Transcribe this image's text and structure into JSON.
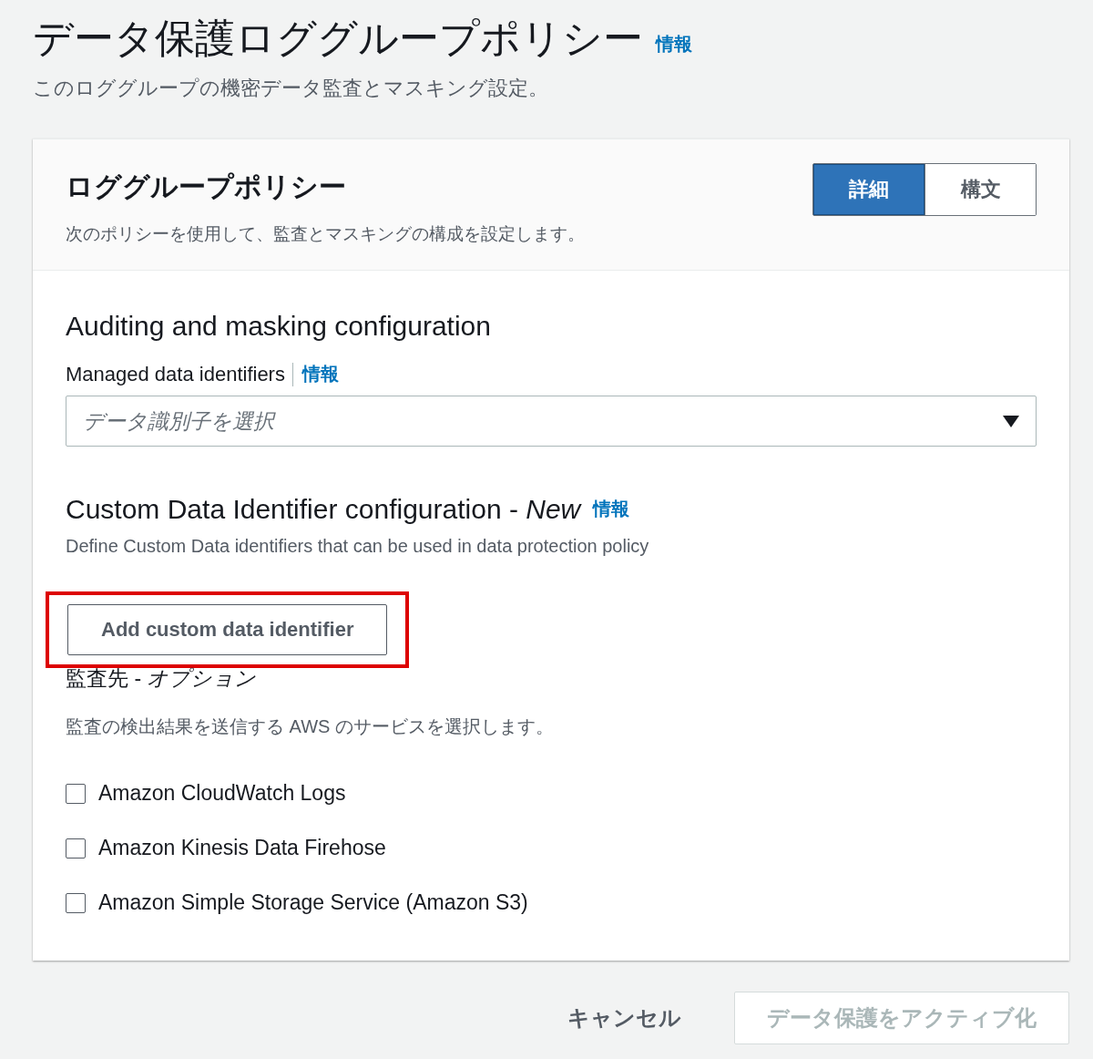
{
  "page": {
    "title": "データ保護ロググループポリシー",
    "info_link": "情報",
    "subtitle": "このロググループの機密データ監査とマスキング設定。"
  },
  "card": {
    "title": "ロググループポリシー",
    "description": "次のポリシーを使用して、監査とマスキングの構成を設定します。",
    "view_toggle": [
      {
        "label": "詳細",
        "selected": true
      },
      {
        "label": "構文",
        "selected": false
      }
    ],
    "auditing": {
      "heading": "Auditing and masking configuration",
      "field_label": "Managed data identifiers",
      "info_link": "情報",
      "placeholder": "データ識別子を選択"
    },
    "custom": {
      "heading": "Custom Data Identifier configuration - *New*",
      "info_link": "情報",
      "description": "Define Custom Data identifiers that can be used in data protection policy",
      "button": "Add custom data identifier",
      "highlighted": true
    },
    "destination": {
      "label": "監査先 - *オプション*",
      "description": "監査の検出結果を送信する AWS のサービスを選択します。",
      "options": [
        {
          "label": "Amazon CloudWatch Logs",
          "checked": false
        },
        {
          "label": "Amazon Kinesis Data Firehose",
          "checked": false
        },
        {
          "label": "Amazon Simple Storage Service (Amazon S3)",
          "checked": false
        }
      ]
    }
  },
  "footer": {
    "cancel": "キャンセル",
    "activate": {
      "label": "データ保護をアクティブ化",
      "disabled": true
    }
  }
}
